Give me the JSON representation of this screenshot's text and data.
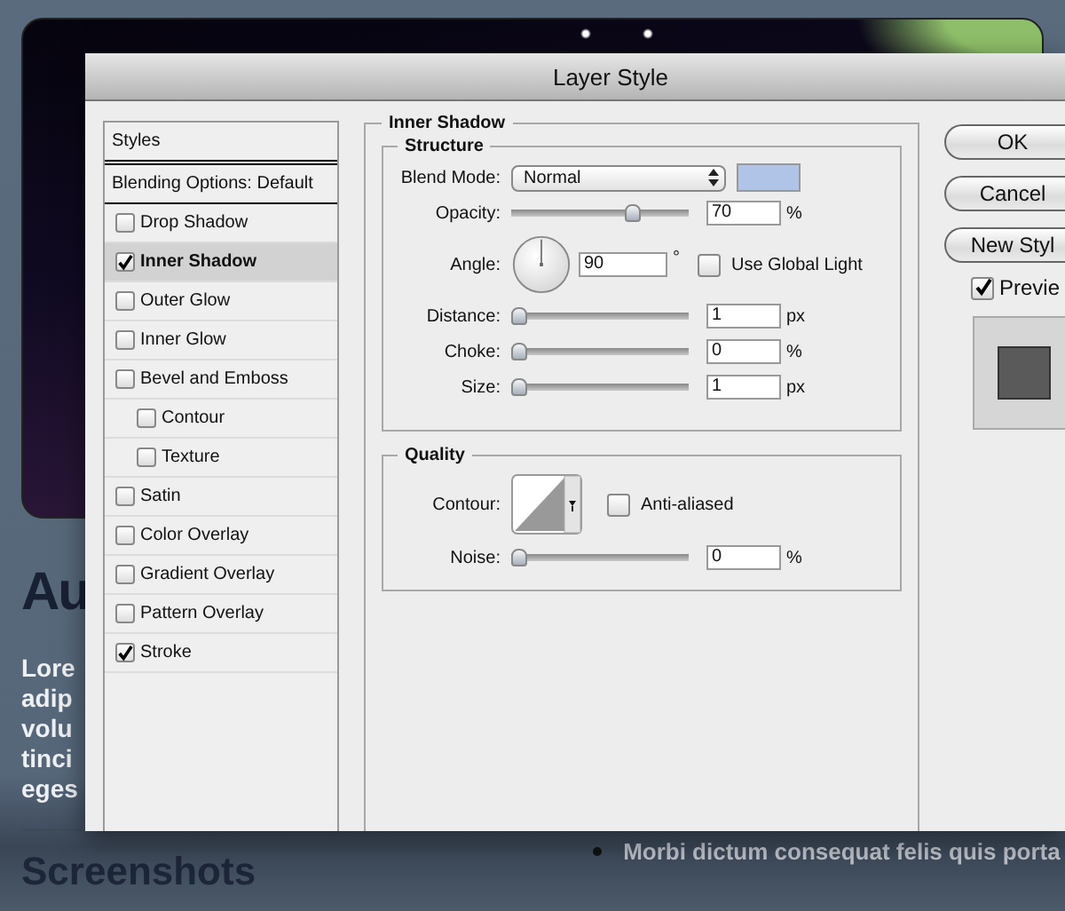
{
  "background": {
    "heading": "Au",
    "paragraph_lines": [
      "Lore",
      "adip",
      "volu",
      "tinci",
      "eges"
    ],
    "section_heading": "Screenshots",
    "bullets": [
      "Morbi dictum consequat felis quis porta"
    ]
  },
  "window": {
    "title": "Layer Style"
  },
  "styles_list": {
    "header": "Styles",
    "blending": "Blending Options: Default",
    "items": [
      {
        "label": "Drop Shadow",
        "checked": false,
        "selected": false
      },
      {
        "label": "Inner Shadow",
        "checked": true,
        "selected": true
      },
      {
        "label": "Outer Glow",
        "checked": false,
        "selected": false
      },
      {
        "label": "Inner Glow",
        "checked": false,
        "selected": false
      },
      {
        "label": "Bevel and Emboss",
        "checked": false,
        "selected": false,
        "children": [
          {
            "label": "Contour",
            "checked": false,
            "selected": false
          },
          {
            "label": "Texture",
            "checked": false,
            "selected": false
          }
        ]
      },
      {
        "label": "Satin",
        "checked": false,
        "selected": false
      },
      {
        "label": "Color Overlay",
        "checked": false,
        "selected": false
      },
      {
        "label": "Gradient Overlay",
        "checked": false,
        "selected": false
      },
      {
        "label": "Pattern Overlay",
        "checked": false,
        "selected": false
      },
      {
        "label": "Stroke",
        "checked": true,
        "selected": false
      }
    ]
  },
  "panel": {
    "title": "Inner Shadow",
    "structure": {
      "title": "Structure",
      "blend_mode": {
        "label": "Blend Mode:",
        "value": "Normal",
        "color": "#b0c4e8"
      },
      "controls": [
        {
          "kind": "slider",
          "label": "Opacity:",
          "level": 0.7,
          "value": "70",
          "unit": "%"
        },
        {
          "kind": "angle",
          "label": "Angle:",
          "value": "90",
          "unit": "°",
          "global_light": {
            "label": "Use Global Light",
            "checked": false
          }
        },
        {
          "kind": "slider",
          "label": "Distance:",
          "level": 0,
          "value": "1",
          "unit": "px"
        },
        {
          "kind": "slider",
          "label": "Choke:",
          "level": 0,
          "value": "0",
          "unit": "%"
        },
        {
          "kind": "slider",
          "label": "Size:",
          "level": 0,
          "value": "1",
          "unit": "px"
        }
      ]
    },
    "quality": {
      "title": "Quality",
      "contour": {
        "label": "Contour:"
      },
      "anti_aliased": {
        "label": "Anti-aliased",
        "checked": false
      },
      "noise": {
        "label": "Noise:",
        "level": 0,
        "value": "0",
        "unit": "%"
      }
    }
  },
  "buttons": [
    "OK",
    "Cancel",
    "New Styl"
  ],
  "preview": {
    "label": "Previe",
    "checked": true
  }
}
